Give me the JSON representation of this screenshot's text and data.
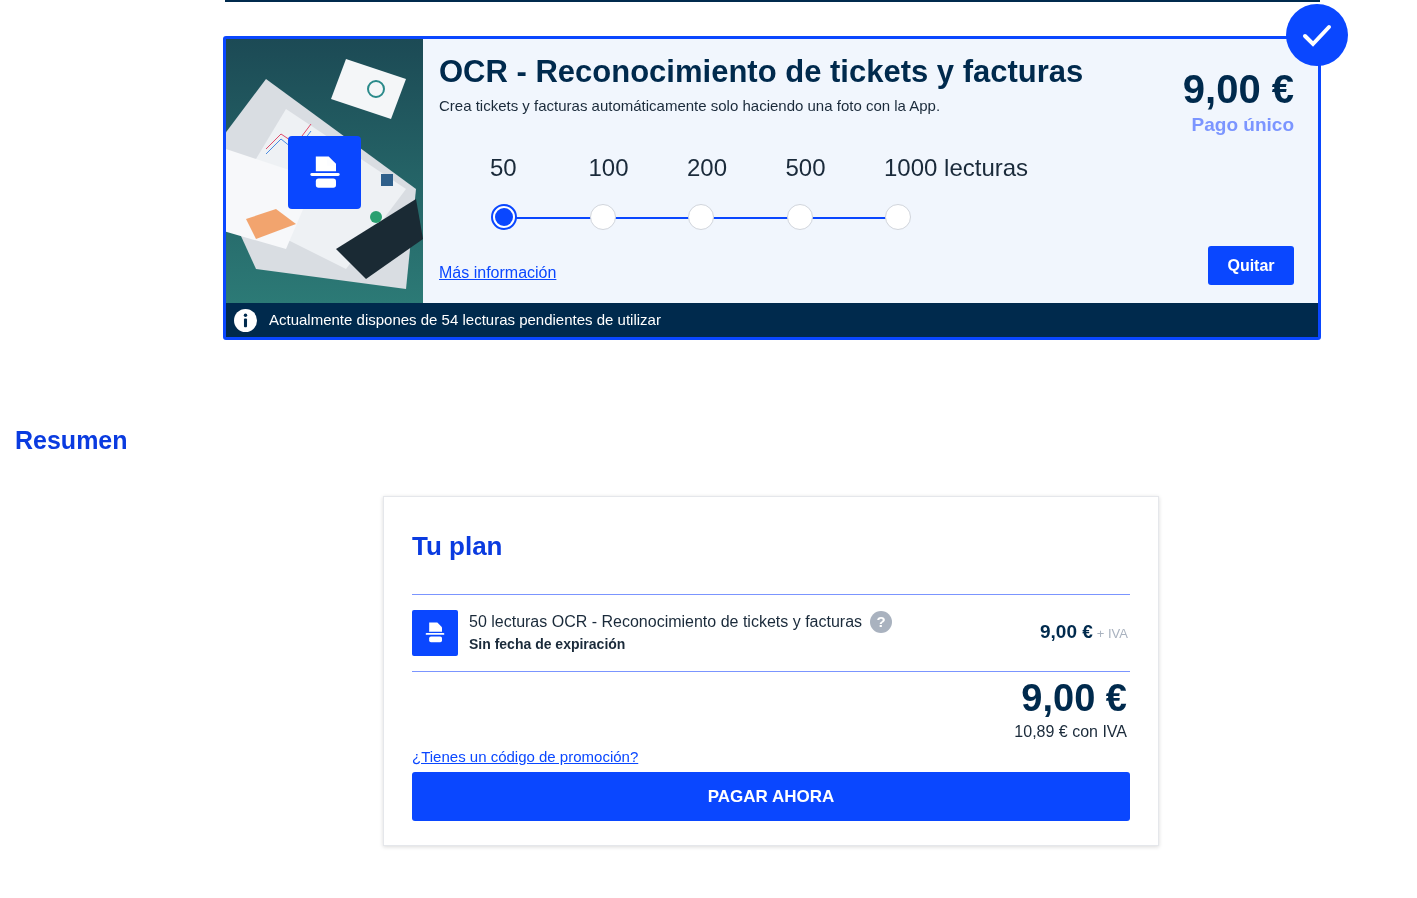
{
  "product_card": {
    "selected": true,
    "title": "OCR - Reconocimiento de tickets y facturas",
    "description": "Crea tickets y facturas automáticamente solo haciendo una foto con la App.",
    "options": [
      {
        "label": "50",
        "selected": true
      },
      {
        "label": "100",
        "selected": false
      },
      {
        "label": "200",
        "selected": false
      },
      {
        "label": "500",
        "selected": false
      },
      {
        "label": "1000 lecturas",
        "selected": false
      }
    ],
    "price": "9,00 €",
    "price_note": "Pago único",
    "more_link": "Más información",
    "remove_button": "Quitar",
    "notice": "Actualmente dispones de 54 lecturas pendientes de utilizar"
  },
  "summary": {
    "heading": "Resumen",
    "plan_title": "Tu plan",
    "line_item": {
      "name": "50 lecturas OCR - Reconocimiento de tickets y facturas",
      "help": "?",
      "detail": "Sin fecha de expiración",
      "price": "9,00 €",
      "tax_note": "+ IVA"
    },
    "total": "9,00 €",
    "total_with_tax": "10,89 € con IVA",
    "promo_link": "¿Tienes un código de promoción?",
    "pay_button": "PAGAR AHORA"
  }
}
